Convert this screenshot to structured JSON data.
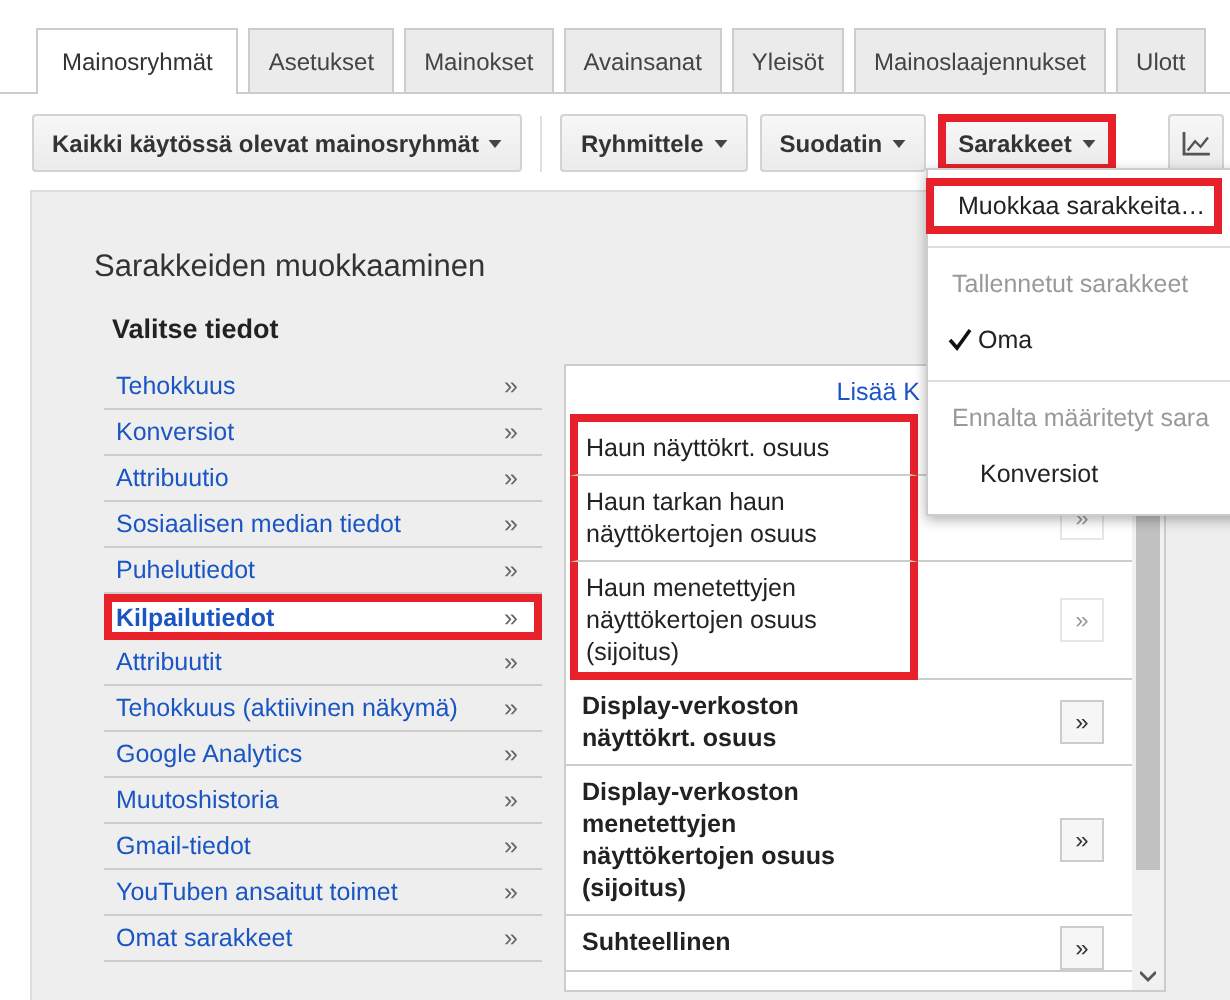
{
  "tabs": [
    {
      "label": "Mainosryhmät",
      "selected": true
    },
    {
      "label": "Asetukset",
      "selected": false
    },
    {
      "label": "Mainokset",
      "selected": false
    },
    {
      "label": "Avainsanat",
      "selected": false
    },
    {
      "label": "Yleisöt",
      "selected": false
    },
    {
      "label": "Mainoslaajennukset",
      "selected": false
    },
    {
      "label": "Ulott",
      "selected": false
    }
  ],
  "toolbar": [
    {
      "kind": "dropdown",
      "label": "Kaikki käytössä olevat mainosryhmät",
      "highlighted": false
    },
    {
      "kind": "separator"
    },
    {
      "kind": "dropdown",
      "label": "Ryhmittele",
      "highlighted": false
    },
    {
      "kind": "dropdown",
      "label": "Suodatin",
      "highlighted": false
    },
    {
      "kind": "dropdown",
      "label": "Sarakkeet",
      "highlighted": true
    },
    {
      "kind": "chart",
      "highlighted": false
    }
  ],
  "menu": [
    {
      "kind": "action",
      "label": "Muokkaa sarakkeita…",
      "highlighted": true
    },
    {
      "kind": "header",
      "label": "Tallennetut sarakkeet"
    },
    {
      "kind": "option",
      "label": "Oma",
      "checked": true
    },
    {
      "kind": "header",
      "label": "Ennalta määritetyt sara"
    },
    {
      "kind": "option",
      "label": "Konversiot",
      "checked": false
    }
  ],
  "editor": {
    "title": "Sarakkeiden muokkaaminen",
    "subtitle": "Valitse tiedot",
    "categories": [
      {
        "label": "Tehokkuus",
        "arrow": "»",
        "selected": false
      },
      {
        "label": "Konversiot",
        "arrow": "»",
        "selected": false
      },
      {
        "label": "Attribuutio",
        "arrow": "»",
        "selected": false
      },
      {
        "label": "Sosiaalisen median tiedot",
        "arrow": "»",
        "selected": false
      },
      {
        "label": "Puhelutiedot",
        "arrow": "»",
        "selected": false
      },
      {
        "label": "Kilpailutiedot",
        "arrow": "»",
        "selected": true
      },
      {
        "label": "Attribuutit",
        "arrow": "»",
        "selected": false
      },
      {
        "label": "Tehokkuus (aktiivinen näkymä)",
        "arrow": "»",
        "selected": false
      },
      {
        "label": "Google Analytics",
        "arrow": "»",
        "selected": false
      },
      {
        "label": "Muutoshistoria",
        "arrow": "»",
        "selected": false
      },
      {
        "label": "Gmail-tiedot",
        "arrow": "»",
        "selected": false
      },
      {
        "label": "YouTuben ansaitut toimet",
        "arrow": "»",
        "selected": false
      },
      {
        "label": "Omat sarakkeet",
        "arrow": "»",
        "selected": false
      }
    ],
    "add_link": "Lisää K",
    "metrics": [
      {
        "label": "Haun näyttökrt. osuus",
        "added": true,
        "highlighted": true
      },
      {
        "label": "Haun tarkan haun näyttökertojen osuus",
        "button": "»",
        "added": true,
        "highlighted": true
      },
      {
        "label": "Haun menetettyjen näyttökertojen osuus (sijoitus)",
        "button": "»",
        "added": true,
        "highlighted": true
      },
      {
        "label": "Display-verkoston näyttökrt. osuus",
        "button": "»",
        "added": false,
        "highlighted": false
      },
      {
        "label": "Display-verkoston menetettyjen näyttökertojen osuus (sijoitus)",
        "button": "»",
        "added": false,
        "highlighted": false
      },
      {
        "label": "Suhteellinen",
        "button": "»",
        "added": false,
        "highlighted": false
      }
    ]
  }
}
